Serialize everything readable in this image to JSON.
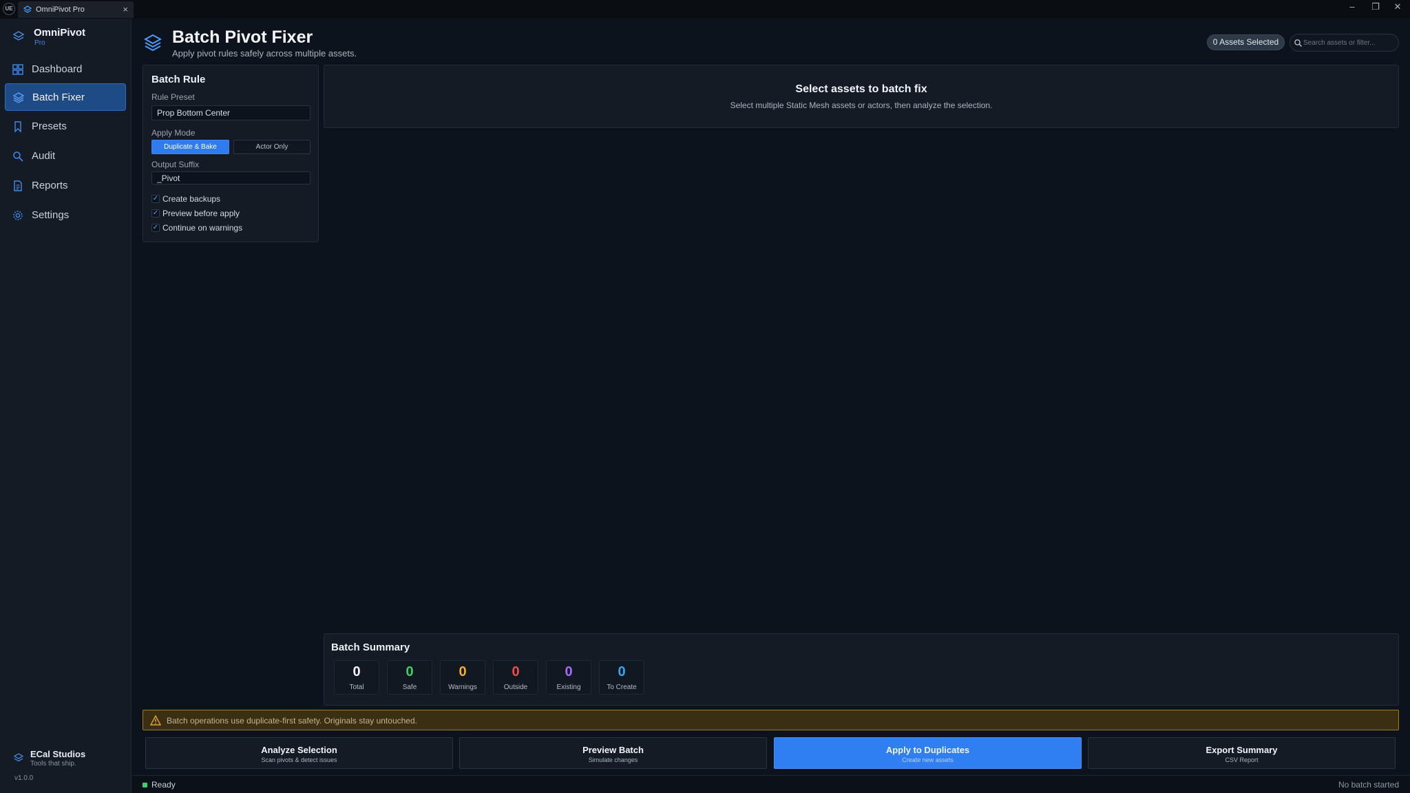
{
  "titlebar": {
    "app_logo_text": "UE",
    "tab_title": "OmniPivot Pro",
    "tab_close": "×",
    "minimize": "–",
    "restore": "❐",
    "close": "✕"
  },
  "sidebar": {
    "brand": "OmniPivot",
    "brand_sub": "Pro",
    "items": [
      {
        "label": "Dashboard",
        "icon": "grid-icon",
        "active": false
      },
      {
        "label": "Batch Fixer",
        "icon": "layers-icon",
        "active": true
      },
      {
        "label": "Presets",
        "icon": "bookmark-icon",
        "active": false
      },
      {
        "label": "Audit",
        "icon": "search-icon",
        "active": false
      },
      {
        "label": "Reports",
        "icon": "document-icon",
        "active": false
      },
      {
        "label": "Settings",
        "icon": "gear-icon",
        "active": false
      }
    ],
    "studio": "ECal Studios",
    "studio_tagline": "Tools that ship.",
    "version": "v1.0.0"
  },
  "header": {
    "title": "Batch Pivot Fixer",
    "subtitle": "Apply pivot rules safely across multiple assets.",
    "assets_badge": "0 Assets Selected",
    "search_placeholder": "Search assets or filter..."
  },
  "batch_rule": {
    "title": "Batch Rule",
    "preset_label": "Rule Preset",
    "preset_value": "Prop Bottom Center",
    "mode_label": "Apply Mode",
    "mode_options": [
      "Duplicate & Bake",
      "Actor Only"
    ],
    "mode_selected": "Duplicate & Bake",
    "suffix_label": "Output Suffix",
    "suffix_value": "_Pivot",
    "options": [
      {
        "label": "Create backups",
        "checked": true
      },
      {
        "label": "Preview before apply",
        "checked": true
      },
      {
        "label": "Continue on warnings",
        "checked": true
      }
    ]
  },
  "empty_state": {
    "title": "Select assets to batch fix",
    "subtitle": "Select multiple Static Mesh assets or actors, then analyze the selection."
  },
  "summary": {
    "title": "Batch Summary",
    "stats": [
      {
        "value": "0",
        "label": "Total",
        "color": "#f2f5f9"
      },
      {
        "value": "0",
        "label": "Safe",
        "color": "#3ecf6b"
      },
      {
        "value": "0",
        "label": "Warnings",
        "color": "#f2b02c"
      },
      {
        "value": "0",
        "label": "Outside",
        "color": "#ef4c4c"
      },
      {
        "value": "0",
        "label": "Existing",
        "color": "#a56cf5"
      },
      {
        "value": "0",
        "label": "To Create",
        "color": "#33a6f2"
      }
    ]
  },
  "warning": {
    "text": "Batch operations use duplicate-first safety. Originals stay untouched."
  },
  "actions": [
    {
      "title": "Analyze Selection",
      "sub": "Scan pivots & detect issues"
    },
    {
      "title": "Preview Batch",
      "sub": "Simulate changes"
    },
    {
      "title": "Apply to Duplicates",
      "sub": "Create new assets"
    },
    {
      "title": "Export Summary",
      "sub": "CSV Report"
    }
  ],
  "status": {
    "left": "Ready",
    "right": "No batch started"
  },
  "colors": {
    "accent": "#2f7ff2",
    "warning_border": "#a37b1e",
    "status_ok": "#3fcf6a"
  }
}
